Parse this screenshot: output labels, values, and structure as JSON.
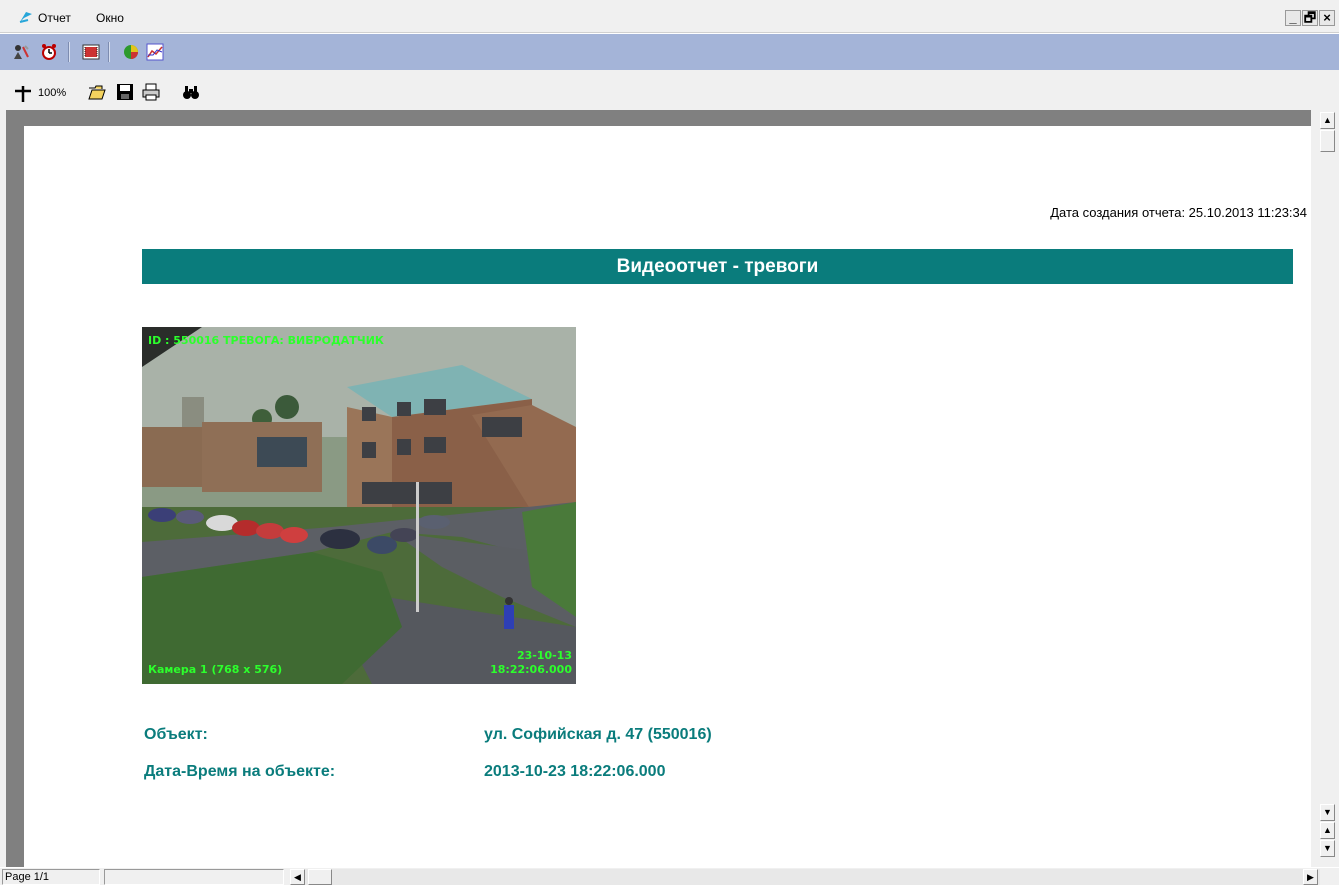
{
  "menubar": {
    "items": [
      "Отчет",
      "Окно"
    ],
    "window_controls": [
      "_",
      "🗗",
      "×"
    ]
  },
  "toolbar1": {
    "icons": [
      "user-tools-icon",
      "alarm-clock-icon",
      "video-report-icon",
      "pie-chart-icon",
      "line-chart-icon"
    ]
  },
  "toolbar2": {
    "zoom_label": "100%",
    "icons": [
      "zoom-icon",
      "open-folder-icon",
      "save-icon",
      "print-icon",
      "find-icon"
    ]
  },
  "report": {
    "created_label": "Дата создания отчета: 25.10.2013 11:23:34",
    "title": "Видеоотчет - тревоги",
    "photo": {
      "overlay_top": "ID : 550016  ТРЕВОГА: ВИБРОДАТЧИК",
      "overlay_bottom_left": "Камера 1 (768 x 576)",
      "overlay_date": "23-10-13",
      "overlay_time": "18:22:06.000"
    },
    "fields": [
      {
        "label": "Объект:",
        "value": "ул. Софийская д. 47 (550016)"
      },
      {
        "label": "Дата-Время на объекте:",
        "value": "2013-10-23 18:22:06.000"
      }
    ]
  },
  "statusbar": {
    "page": "Page 1/1"
  },
  "colors": {
    "accent": "#0a7c7c",
    "toolbar": "#a4b4d8"
  }
}
